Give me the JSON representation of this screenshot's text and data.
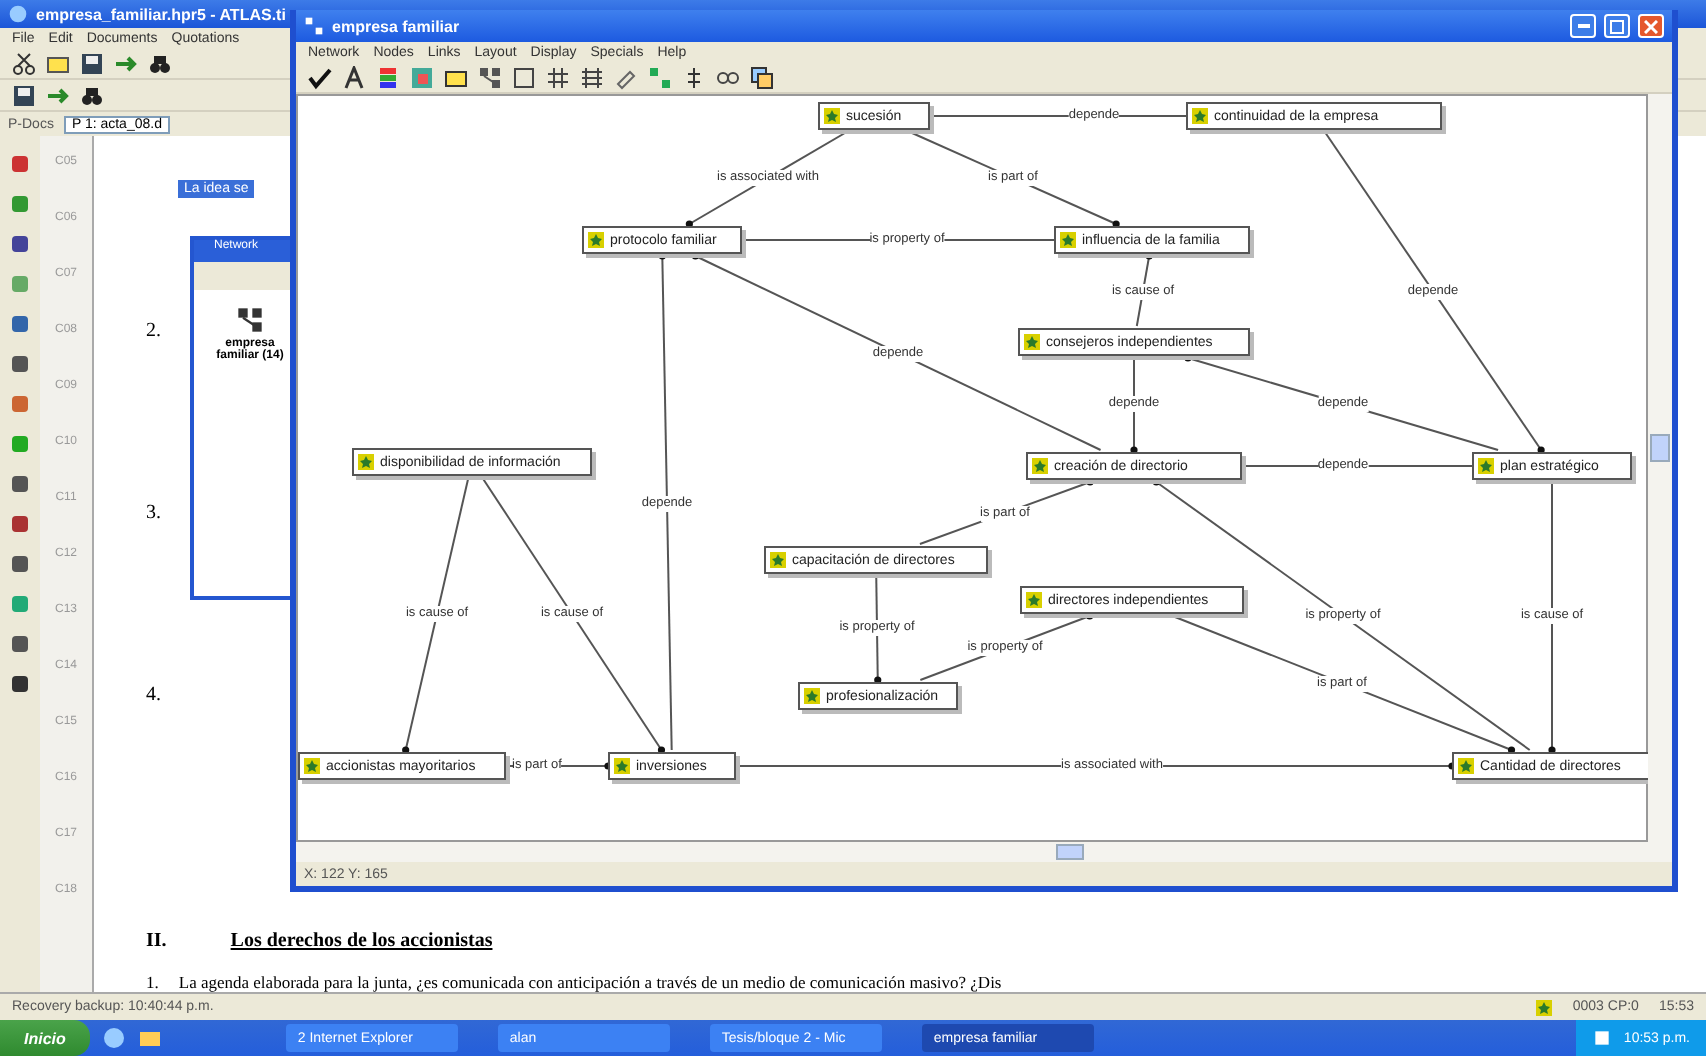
{
  "main_window": {
    "title": "empresa_familiar.hpr5 - ATLAS.ti",
    "menu": [
      "File",
      "Edit",
      "Documents",
      "Quotations"
    ],
    "docs_label": "P-Docs",
    "doc_selector": "P 1: acta_08.d",
    "highlight": "La idea se",
    "line_numbers": [
      "C05",
      "C06",
      "C07",
      "C08",
      "C09",
      "C10",
      "C11",
      "C12",
      "C13",
      "C14",
      "C15",
      "C16",
      "C17",
      "C18"
    ],
    "items": [
      "2.",
      "3.",
      "4."
    ],
    "section_number": "II.",
    "section_title": "Los derechos de los accionistas",
    "paragraph_number": "1.",
    "paragraph": "La agenda elaborada para la junta, ¿es comunicada con anticipación a través de un medio de comunicación masivo? ¿Dis"
  },
  "network_manager": {
    "title": "Network",
    "item": "empresa familiar (14)"
  },
  "network_window": {
    "title": "empresa familiar",
    "menu": [
      "Network",
      "Nodes",
      "Links",
      "Layout",
      "Display",
      "Specials",
      "Help"
    ],
    "status": "X: 122 Y: 165",
    "nodes": [
      {
        "label": "sucesión"
      },
      {
        "label": "continuidad de la empresa"
      },
      {
        "label": "protocolo familiar"
      },
      {
        "label": "influencia de la familia"
      },
      {
        "label": "consejeros independientes"
      },
      {
        "label": "disponibilidad de información"
      },
      {
        "label": "creación de directorio"
      },
      {
        "label": "plan estratégico"
      },
      {
        "label": "capacitación de directores"
      },
      {
        "label": "directores independientes"
      },
      {
        "label": "profesionalización"
      },
      {
        "label": "accionistas mayoritarios"
      },
      {
        "label": "inversiones"
      },
      {
        "label": "Cantidad de directores"
      }
    ],
    "links": [
      {
        "label": "depende"
      },
      {
        "label": "is associated with"
      },
      {
        "label": "is part of"
      },
      {
        "label": "is property of"
      },
      {
        "label": "is cause of"
      },
      {
        "label": "depende"
      },
      {
        "label": "depende"
      },
      {
        "label": "depende"
      },
      {
        "label": "depende"
      },
      {
        "label": "depende"
      },
      {
        "label": "depende"
      },
      {
        "label": "is part of"
      },
      {
        "label": "is cause of"
      },
      {
        "label": "is cause of"
      },
      {
        "label": "is property of"
      },
      {
        "label": "is cause of"
      },
      {
        "label": "is property of"
      },
      {
        "label": "is property of"
      },
      {
        "label": "is part of"
      },
      {
        "label": "is part of"
      },
      {
        "label": "is associated with"
      }
    ]
  },
  "status_bar": {
    "message": "Recovery backup: 10:40:44 p.m.",
    "code": "0003 CP:0",
    "time": "15:53"
  },
  "taskbar": {
    "start": "Inicio",
    "tasks": [
      {
        "label": "2 Internet Explorer",
        "selected": false
      },
      {
        "label": "alan",
        "selected": false
      },
      {
        "label": "Tesis/bloque 2 - Mic",
        "selected": false
      },
      {
        "label": "empresa familiar",
        "selected": true
      }
    ],
    "clock": "10:53 p.m."
  }
}
